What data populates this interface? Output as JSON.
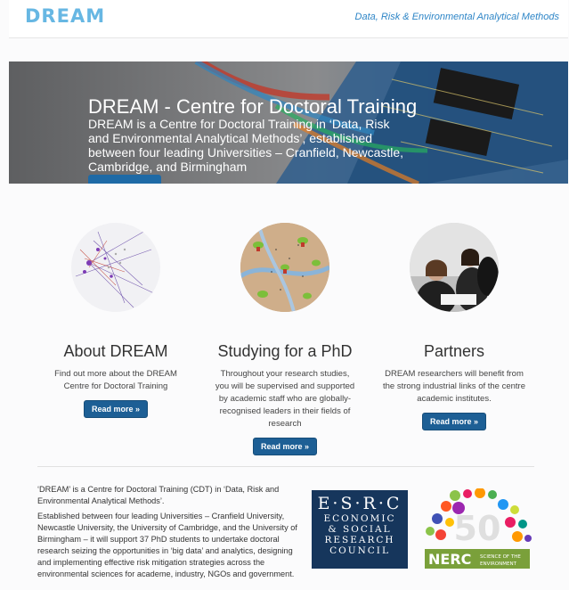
{
  "header": {
    "logo": "DREAM",
    "tagline": "Data, Risk & Environmental Analytical Methods"
  },
  "hero": {
    "title": "DREAM - Centre for Doctoral Training",
    "text": "DREAM is a Centre for Doctoral Training in ‘Data, Risk and Environmental Analytical Methods’, established between four leading Universities – Cranfield, Newcastle, Cambridge, and Birmingham"
  },
  "columns": [
    {
      "title": "About DREAM",
      "text": "Find out more about the DREAM Centre for Doctoral Training",
      "button": "Read more »"
    },
    {
      "title": "Studying for a PhD",
      "text": "Throughout your research studies, you will be supervised and supported by academic staff who are globally-recognised leaders in their fields of research",
      "button": "Read more »"
    },
    {
      "title": "Partners",
      "text": "DREAM researchers will benefit from the strong industrial links of the centre academic institutes.",
      "button": "Read more »"
    }
  ],
  "about": {
    "p1": "‘DREAM’ is a Centre for Doctoral Training (CDT) in ‘Data, Risk and Environmental Analytical Methods’.",
    "p2": "Established between four leading Universities – Cranfield University, Newcastle University, the University of Cambridge, and the University of Birmingham – it will support 37 PhD students to undertake doctoral research seizing the opportunities in ‘big data’ and analytics, designing and implementing effective risk mitigation strategies across the environmental sciences for academe, industry, NGOs and government."
  },
  "logos": {
    "esrc_letters": "E·S·R·C",
    "esrc_line1": "ECONOMIC",
    "esrc_line2": "& SOCIAL",
    "esrc_line3": "RESEARCH",
    "esrc_line4": "COUNCIL",
    "nerc_number": "50",
    "nerc_name": "NERC",
    "nerc_sub1": "SCIENCE OF THE",
    "nerc_sub2": "ENVIRONMENT"
  },
  "colors": {
    "logo": "#67b7e3",
    "tagline": "#2f86c7",
    "button": "#1d5f95",
    "esrc_bg": "#16365c",
    "nerc_green": "#7aa03a"
  }
}
